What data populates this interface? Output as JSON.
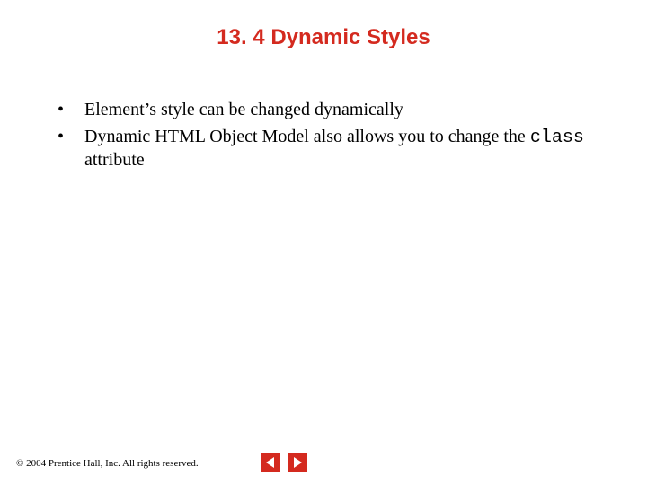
{
  "title": "13. 4  Dynamic Styles",
  "bullets": [
    {
      "pre": "Element’s style can be changed dynamically",
      "code": "",
      "post": ""
    },
    {
      "pre": "Dynamic HTML Object Model also allows you to change the ",
      "code": "class",
      "post": " attribute"
    }
  ],
  "footer": "© 2004 Prentice Hall, Inc.  All rights reserved.",
  "nav": {
    "prev": "previous slide",
    "next": "next slide"
  }
}
